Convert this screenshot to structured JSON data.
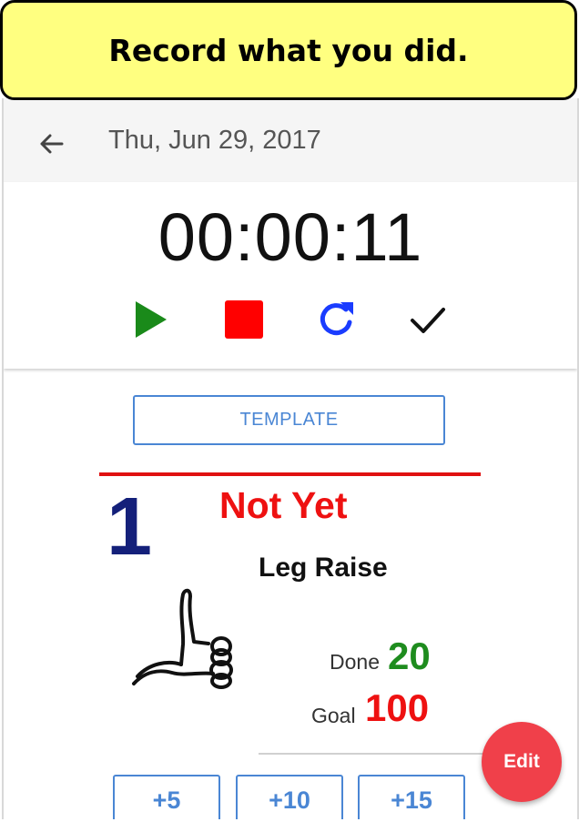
{
  "banner": {
    "text": "Record what you did."
  },
  "header": {
    "back_icon": "arrow-left-icon",
    "date": "Thu, Jun 29, 2017"
  },
  "timer": {
    "display": "00:00:11",
    "controls": [
      {
        "name": "play-icon",
        "color": "#1a8a1a"
      },
      {
        "name": "stop-icon",
        "color": "#ff0000"
      },
      {
        "name": "refresh-icon",
        "color": "#1a3cff"
      },
      {
        "name": "check-icon",
        "color": "#111111"
      }
    ]
  },
  "template_label": "TEMPLATE",
  "set": {
    "number": "1",
    "status": "Not Yet",
    "exercise": "Leg Raise",
    "done_label": "Done",
    "done_value": "20",
    "goal_label": "Goal",
    "goal_value": "100"
  },
  "increments": [
    "+5",
    "+10",
    "+15"
  ],
  "fab_label": "Edit",
  "colors": {
    "accent_blue": "#4a86d4",
    "status_red": "#ee1111",
    "done_green": "#1e8c1e",
    "number_navy": "#14207a",
    "fab_red": "#f0404a",
    "banner_yellow": "#ffff80"
  }
}
